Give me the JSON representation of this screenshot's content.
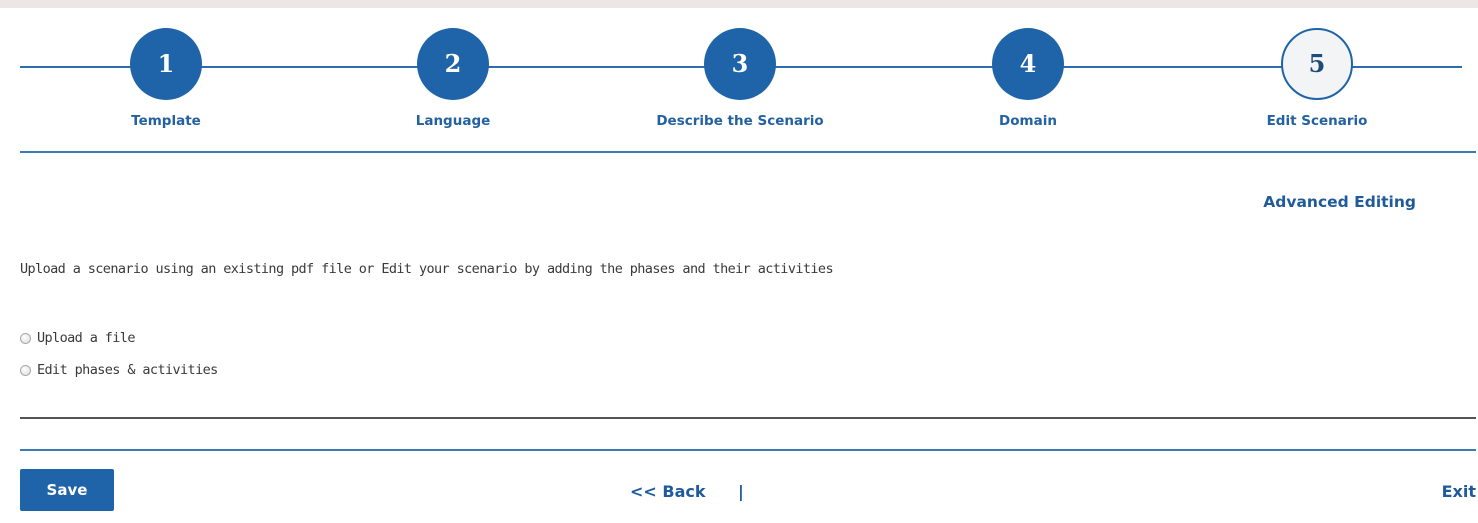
{
  "wizard": {
    "steps": [
      {
        "number": "1",
        "label": "Template",
        "state": "done"
      },
      {
        "number": "2",
        "label": "Language",
        "state": "done"
      },
      {
        "number": "3",
        "label": "Describe the Scenario",
        "state": "done"
      },
      {
        "number": "4",
        "label": "Domain",
        "state": "done"
      },
      {
        "number": "5",
        "label": "Edit Scenario",
        "state": "current"
      }
    ]
  },
  "main": {
    "advanced_editing_label": "Advanced Editing",
    "intro_text": "Upload a scenario using an existing pdf file or Edit your scenario by adding the phases and their activities",
    "options": [
      {
        "label": "Upload a file",
        "selected": false
      },
      {
        "label": "Edit phases & activities",
        "selected": false
      }
    ]
  },
  "footer": {
    "save_label": "Save",
    "back_label": "<< Back",
    "separator": "|",
    "exit_label": "Exit"
  },
  "colors": {
    "primary": "#1f64a8",
    "link": "#1f5a9a",
    "background": "#ffffff",
    "outer_background": "#ece7e4"
  }
}
